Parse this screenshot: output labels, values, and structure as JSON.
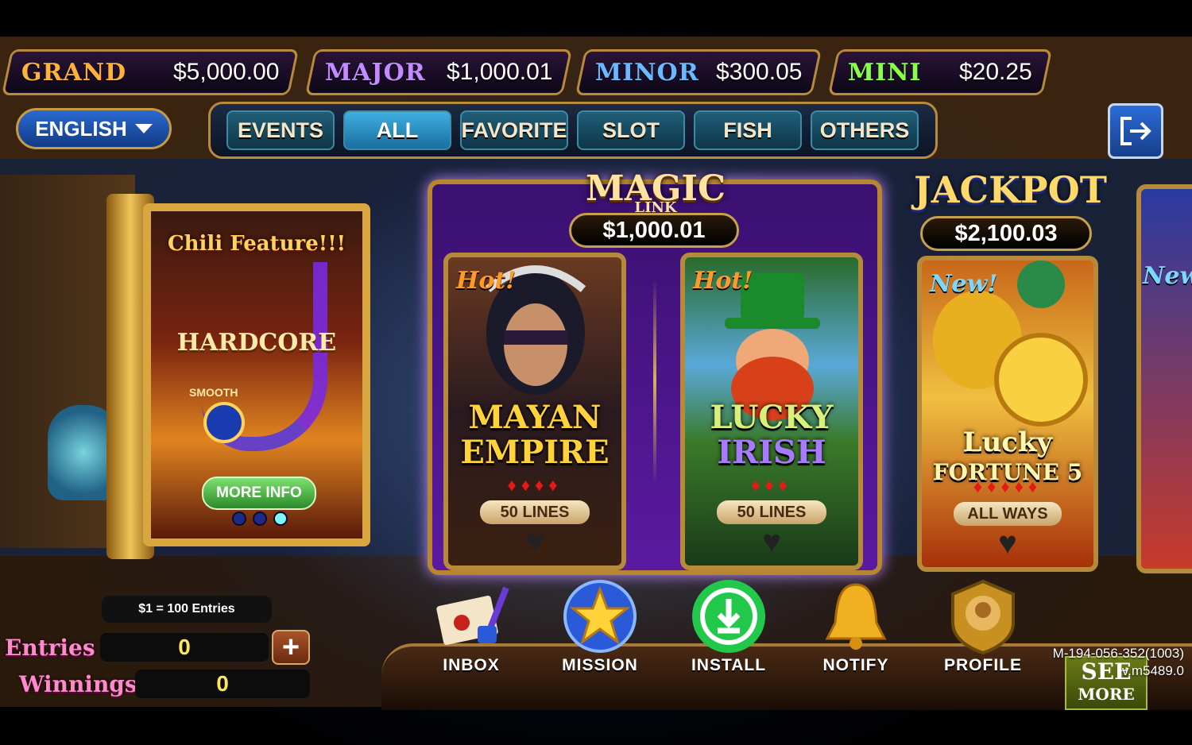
{
  "jackpots": [
    {
      "name": "GRAND",
      "value": "$5,000.00",
      "color": "#ffb23a"
    },
    {
      "name": "MAJOR",
      "value": "$1,000.01",
      "color": "#c48aff"
    },
    {
      "name": "MINOR",
      "value": "$300.05",
      "color": "#6ab8ff"
    },
    {
      "name": "MINI",
      "value": "$20.25",
      "color": "#8aff4a"
    }
  ],
  "language": {
    "label": "ENGLISH",
    "icon": "chevron-down-icon"
  },
  "tabs": [
    {
      "label": "EVENTS",
      "active": false
    },
    {
      "label": "ALL",
      "active": true
    },
    {
      "label": "FAVORITE",
      "active": false
    },
    {
      "label": "SLOT",
      "active": false
    },
    {
      "label": "FISH",
      "active": false
    },
    {
      "label": "OTHERS",
      "active": false
    }
  ],
  "logout": {
    "icon": "logout-icon"
  },
  "promo": {
    "title": "Chili Feature!!!",
    "level_high": "HARDCORE",
    "level_low": "SMOOTH",
    "button": "MORE INFO",
    "pages": 3,
    "active_page": 3
  },
  "magic_link": {
    "title": "MAGIC",
    "subtitle": "LINK",
    "jackpot": "$1,000.01"
  },
  "jackpot_group": {
    "title": "JACKPOT",
    "value": "$2,100.03"
  },
  "games": [
    {
      "tag": "Hot!",
      "title_line1": "MAYAN",
      "title_line2": "EMPIRE",
      "lines": "50 LINES",
      "peppers": 4
    },
    {
      "tag": "Hot!",
      "title_line1": "LUCKY",
      "title_line2": "IRISH",
      "lines": "50 LINES",
      "peppers": 3
    },
    {
      "tag": "New!",
      "title_line1": "Lucky",
      "title_line2": "FORTUNE 5",
      "lines": "ALL WAYS",
      "peppers": 5
    }
  ],
  "partial_card": {
    "tag": "New!"
  },
  "nav": [
    {
      "label": "INBOX",
      "icon": "envelope-quill-icon"
    },
    {
      "label": "MISSION",
      "icon": "star-gem-icon"
    },
    {
      "label": "INSTALL",
      "icon": "download-icon"
    },
    {
      "label": "NOTIFY",
      "icon": "bell-icon"
    },
    {
      "label": "PROFILE",
      "icon": "avatar-badge-icon"
    }
  ],
  "see_more": {
    "line1": "SEE",
    "line2": "MORE"
  },
  "account": {
    "id": "M-194-056-352(1003)",
    "version": "v.m5489.0"
  },
  "entries": {
    "rate": "$1 = 100 Entries",
    "entries_label": "Entries",
    "entries_value": "0",
    "winnings_label": "Winnings",
    "winnings_value": "0"
  }
}
